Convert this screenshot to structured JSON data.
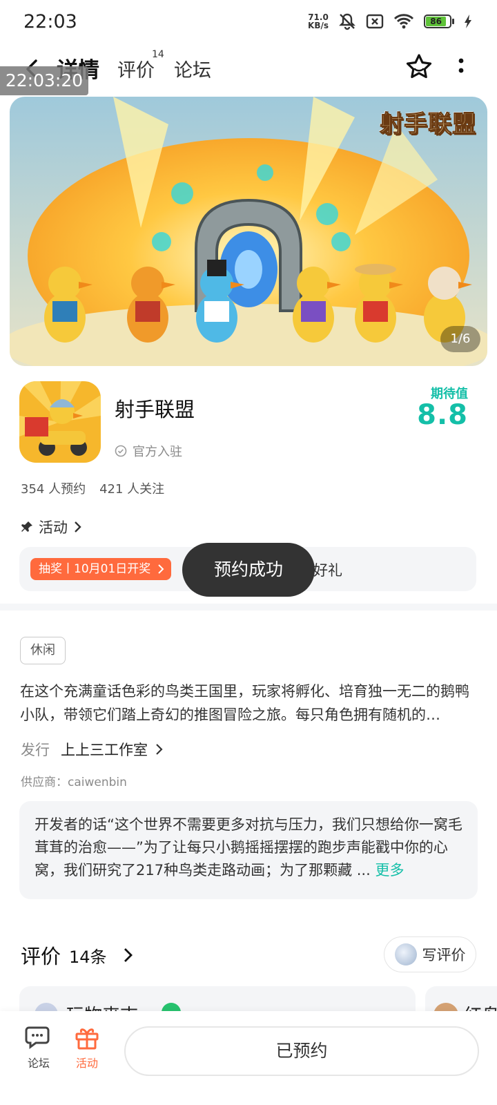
{
  "status_bar": {
    "time": "22:03",
    "net_speed_value": "71.0",
    "net_speed_unit": "KB/s",
    "battery_level": "86"
  },
  "header": {
    "tabs": [
      {
        "label": "详情"
      },
      {
        "label": "评价"
      },
      {
        "label": "论坛"
      }
    ],
    "review_badge": "14",
    "accent_color": "#16c8b5"
  },
  "overlay_timestamp": "22:03:20",
  "banner": {
    "logo_text": "射手联盟",
    "indicator": "1/6"
  },
  "app": {
    "name": "射手联盟",
    "official_label": "官方入驻",
    "expect_label": "期待值",
    "expect_value": "8.8",
    "reservations": "354 人预约",
    "followers": "421 人关注"
  },
  "activity": {
    "section_label": "活动",
    "lottery_badge": "抽奖丨10月01日开奖",
    "text": "【射手联盟】预约好礼",
    "brand_color": "#ff6a3d"
  },
  "toast": "预约成功",
  "details": {
    "tag": "休闲",
    "description": "在这个充满童话色彩的鸟类王国里，玩家将孵化、培育独一无二的鹅鸭小队，带领它们踏上奇幻的推图冒险之旅。每只角色拥有随机的…",
    "publisher_label": "发行",
    "publisher_name": "上上三工作室",
    "supplier": "供应商：caiwenbin",
    "dev_words": "开发者的话“这个世界不需要更多对抗与压力，我们只想给你一窝毛茸茸的治愈——”为了让每只小鹅摇摇摆摆的跑步声能戳中你的心窝，我们研究了217种鸟类走路动画；为了那颗藏 ...",
    "dev_more": "更多"
  },
  "reviews": {
    "title": "评价",
    "count": "14条",
    "write_button": "写评价",
    "first_reviewer": "玩物丧志",
    "second_reviewer": "红鸟"
  },
  "bottom_nav": {
    "forum_label": "论坛",
    "activity_label": "活动",
    "reserved_button": "已预约"
  }
}
